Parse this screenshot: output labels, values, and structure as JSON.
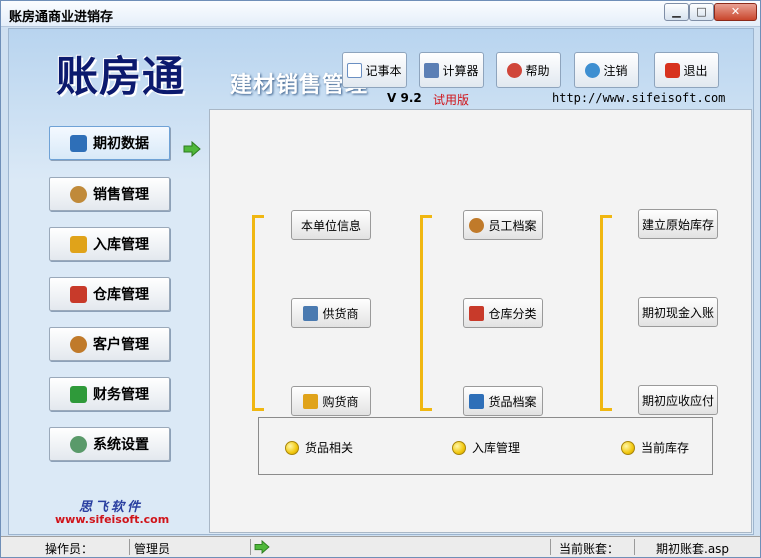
{
  "window": {
    "title": "账房通商业进销存",
    "controls": {
      "minimize": "▁",
      "maximize": "□",
      "close": "✕"
    }
  },
  "header": {
    "logo": "账房通",
    "subtitle": "建材销售管理",
    "version": "V 9.2",
    "trial": "试用版",
    "website": "http://www.sifeisoft.com"
  },
  "toolbar": [
    {
      "label": "记事本",
      "icon": "notepad-icon",
      "color": "#6a8fc2"
    },
    {
      "label": "计算器",
      "icon": "calculator-icon",
      "color": "#5b7fb5"
    },
    {
      "label": "帮助",
      "icon": "help-icon",
      "color": "#d0463a"
    },
    {
      "label": "注销",
      "icon": "logoff-icon",
      "color": "#3e8fd1"
    },
    {
      "label": "退出",
      "icon": "exit-icon",
      "color": "#d7321e"
    }
  ],
  "sidebar": [
    {
      "label": "期初数据",
      "icon": "book-icon",
      "color": "#2e6fb8",
      "active": true
    },
    {
      "label": "销售管理",
      "icon": "user-icon",
      "color": "#c08a3a",
      "active": false
    },
    {
      "label": "入库管理",
      "icon": "box-icon",
      "color": "#e0a31a",
      "active": false
    },
    {
      "label": "仓库管理",
      "icon": "house-icon",
      "color": "#c83a2a",
      "active": false
    },
    {
      "label": "客户管理",
      "icon": "users-icon",
      "color": "#c07a2a",
      "active": false
    },
    {
      "label": "财务管理",
      "icon": "money-icon",
      "color": "#2f9a3a",
      "active": false
    },
    {
      "label": "系统设置",
      "icon": "gears-icon",
      "color": "#5a9a6a",
      "active": false
    }
  ],
  "panel": {
    "col1": [
      {
        "label": "本单位信息",
        "icon": ""
      },
      {
        "label": "供货商",
        "icon": "supplier-icon",
        "color": "#4a7ab0"
      },
      {
        "label": "购货商",
        "icon": "buyer-icon",
        "color": "#e0a31a"
      }
    ],
    "col2": [
      {
        "label": "员工档案",
        "icon": "employee-icon",
        "color": "#c07a2a"
      },
      {
        "label": "仓库分类",
        "icon": "warehouse-category-icon",
        "color": "#c83a2a"
      },
      {
        "label": "货品档案",
        "icon": "goods-file-icon",
        "color": "#2e6fb8"
      }
    ],
    "col3": [
      {
        "label": "建立原始库存",
        "icon": ""
      },
      {
        "label": "期初现金入账",
        "icon": ""
      },
      {
        "label": "期初应收应付",
        "icon": ""
      }
    ],
    "legend": [
      "货品相关",
      "入库管理",
      "当前库存"
    ],
    "bracket_color": "#f0b711"
  },
  "company": {
    "name": "思飞软件",
    "url": "www.sifeisoft.com"
  },
  "status": {
    "operator_label": "操作员：",
    "operator_value": "管理员",
    "account_label": "当前账套：",
    "account_value": "期初账套.asp"
  }
}
